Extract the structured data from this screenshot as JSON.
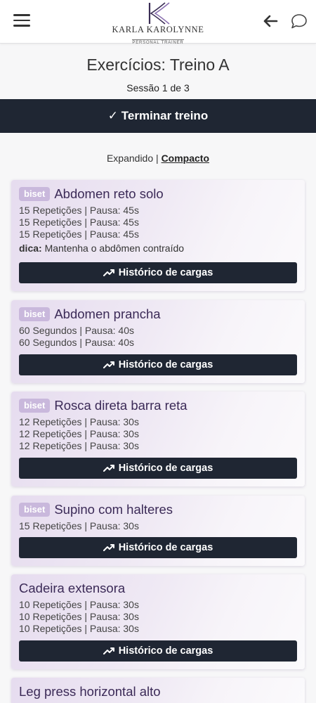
{
  "header": {
    "brand_name": "KARLA KAROLYNNE",
    "brand_sub": "PERSONAL TRAINER",
    "menu_icon": "hamburger-icon",
    "back_icon": "arrow-left-icon",
    "chat_icon": "chat-bubble-icon"
  },
  "page": {
    "title": "Exercícios: Treino A",
    "session": "Sessão 1 de 3",
    "finish_label": "✓ Terminar treino"
  },
  "view": {
    "expanded": "Expandido",
    "separator": " | ",
    "compact": "Compacto"
  },
  "history_label": "Histórico de cargas",
  "exercises": [
    {
      "badge": "biset",
      "name": "Abdomen reto solo",
      "lines": [
        "15 Repetições | Pausa: 45s",
        "15 Repetições | Pausa: 45s",
        "15 Repetições | Pausa: 45s"
      ],
      "tip_label": "dica:",
      "tip_text": " Mantenha o abdômen contraído"
    },
    {
      "badge": "biset",
      "name": "Abdomen prancha",
      "lines": [
        "60 Segundos | Pausa: 40s",
        "60 Segundos | Pausa: 40s"
      ]
    },
    {
      "badge": "biset",
      "name": "Rosca direta barra reta",
      "lines": [
        "12 Repetições | Pausa: 30s",
        "12 Repetições | Pausa: 30s",
        "12 Repetições | Pausa: 30s"
      ]
    },
    {
      "badge": "biset",
      "name": "Supino com halteres",
      "lines": [
        "15 Repetições | Pausa: 30s"
      ]
    },
    {
      "badge": "",
      "name": "Cadeira extensora",
      "lines": [
        "10 Repetições | Pausa: 30s",
        "10 Repetições | Pausa: 30s",
        "10 Repetições | Pausa: 30s"
      ]
    },
    {
      "badge": "",
      "name": "Leg press horizontal alto",
      "lines": []
    }
  ]
}
